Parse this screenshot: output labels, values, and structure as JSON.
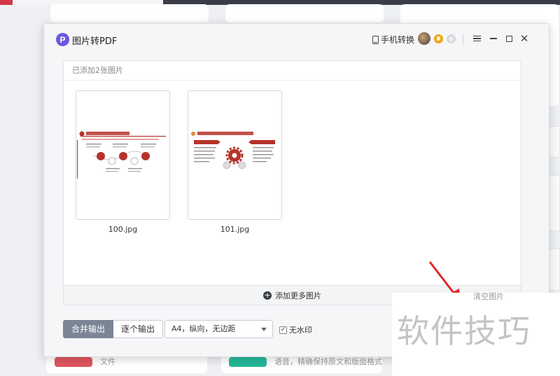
{
  "dialog": {
    "title": "图片转PDF",
    "phone_convert_label": "手机转换",
    "close_glyph": "✕"
  },
  "panel": {
    "header": "已添加2张图片",
    "files": [
      {
        "name": "100.jpg",
        "preview_heading": "强化课程意识，树立学科组长意识"
      },
      {
        "name": "101.jpg",
        "preview_heading": "争先创优，扎实推进财务工作"
      }
    ],
    "add_more_label": "添加更多图片",
    "clear_label": "清空图片"
  },
  "controls": {
    "merge_output_label": "合并输出",
    "single_output_label": "逐个输出",
    "page_setting_value": "A4，纵向，无边距",
    "no_watermark_label": "无水印",
    "no_watermark_checked": true
  },
  "background": {
    "card_labels": [
      "文件",
      "语音，精确保持原文和版面格式"
    ]
  },
  "overlay": {
    "watermark_text": "软件技巧"
  },
  "colors": {
    "accent_purple": "#6b58e0",
    "segment_active": "#7b8595",
    "preview_red": "#b5332a",
    "arrow_red": "#e02a2a"
  }
}
